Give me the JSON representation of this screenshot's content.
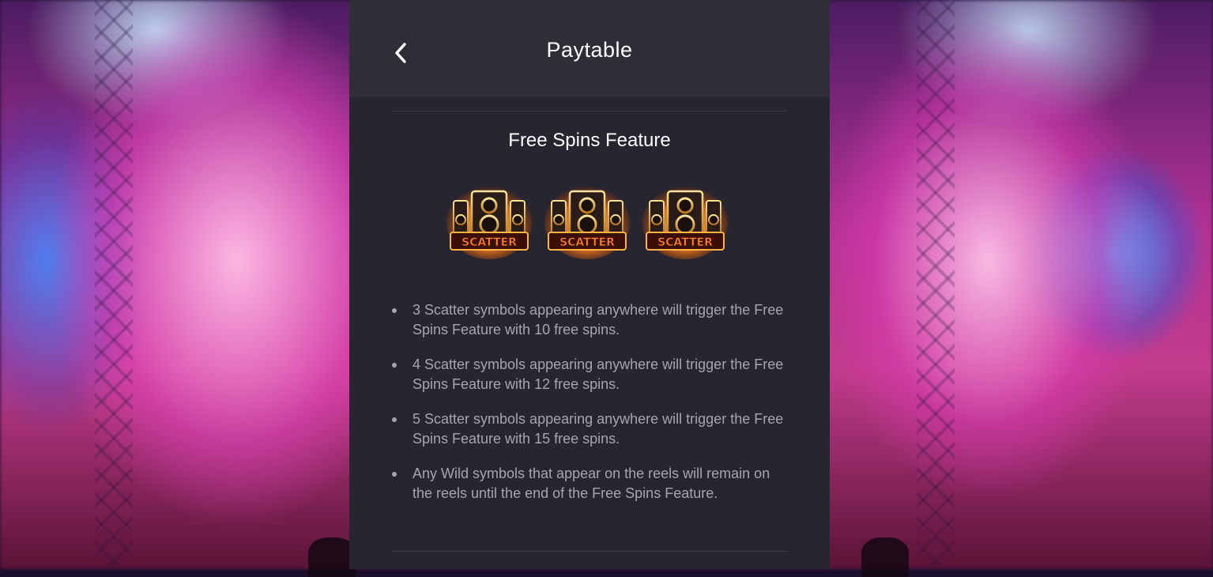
{
  "header": {
    "title": "Paytable",
    "back_icon": "chevron-left-icon"
  },
  "section": {
    "title": "Free Spins Feature",
    "symbols": [
      {
        "name": "scatter-symbol",
        "label": "SCATTER"
      },
      {
        "name": "scatter-symbol",
        "label": "SCATTER"
      },
      {
        "name": "scatter-symbol",
        "label": "SCATTER"
      }
    ],
    "rules": [
      "3 Scatter symbols appearing anywhere will trigger the Free Spins Feature with 10 free spins.",
      "4 Scatter symbols appearing anywhere will trigger the Free Spins Feature with 12 free spins.",
      "5 Scatter symbols appearing anywhere will trigger the Free Spins Feature with 15 free spins.",
      "Any Wild symbols that appear on the reels will remain on the reels until the end of the Free Spins Feature."
    ]
  },
  "colors": {
    "panel_bg": "#272630",
    "header_bg": "#2f2e37",
    "text_primary": "#ffffff",
    "text_secondary": "#a6a5ad",
    "scatter_orange": "#f07a1a"
  }
}
